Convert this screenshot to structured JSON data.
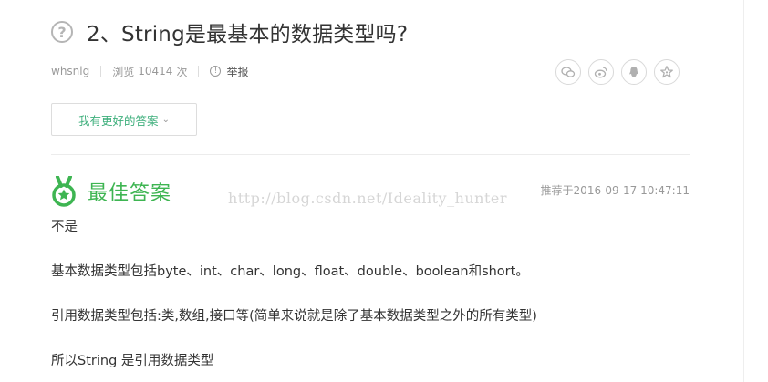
{
  "question": {
    "icon": "question-circle-icon",
    "title": "2、String是最基本的数据类型吗?"
  },
  "meta": {
    "author": "whsnlg",
    "views_label": "浏览",
    "views_count": "10414",
    "views_unit": "次",
    "report_label": "举报"
  },
  "share": {
    "icons": [
      "wechat-icon",
      "weibo-icon",
      "qq-icon",
      "favorite-star-icon"
    ]
  },
  "better_answer_button": {
    "label": "我有更好的答案"
  },
  "best_answer": {
    "label": "最佳答案",
    "recommended_time": "推荐于2016-09-17 10:47:11",
    "watermark": "http://blog.csdn.net/Ideality_hunter",
    "lines": [
      "不是",
      "基本数据类型包括byte、int、char、long、float、double、boolean和short。",
      "引用数据类型包括:类,数组,接口等(简单来说就是除了基本数据类型之外的所有类型)",
      "所以String 是引用数据类型"
    ]
  },
  "colors": {
    "accent_green": "#3eb552",
    "link_green": "#3eaf7c",
    "muted_text": "#999999"
  }
}
